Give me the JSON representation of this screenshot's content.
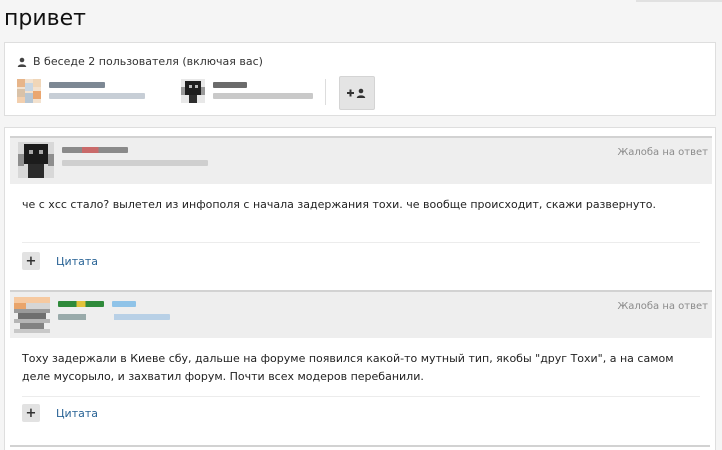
{
  "page": {
    "title": "привет"
  },
  "participants": {
    "heading": "В беседе 2 пользователя (включая вас)",
    "members": [
      {
        "avatar": "pixelated-avatar-1"
      },
      {
        "avatar": "pixelated-avatar-2"
      }
    ],
    "add_button_icon": "add-user-icon"
  },
  "posts": [
    {
      "report_label": "Жалоба на ответ",
      "text": "че с хсс стало? вылетел из инфополя с начала задержания тохи. че вообще происходит, скажи развернуто.",
      "quote_label": "Цитата"
    },
    {
      "report_label": "Жалоба на ответ",
      "text": "Тоху задержали в Киеве сбу, дальше на форуме появился какой-то мутный тип, якобы \"друг Тохи\", а на самом деле мусорыло, и захватил форум. Почти всех модеров перебанили.",
      "quote_label": "Цитата"
    }
  ],
  "colors": {
    "link": "#2a6496",
    "muted": "#8a8a8a",
    "header_bg": "#eeeeee"
  }
}
